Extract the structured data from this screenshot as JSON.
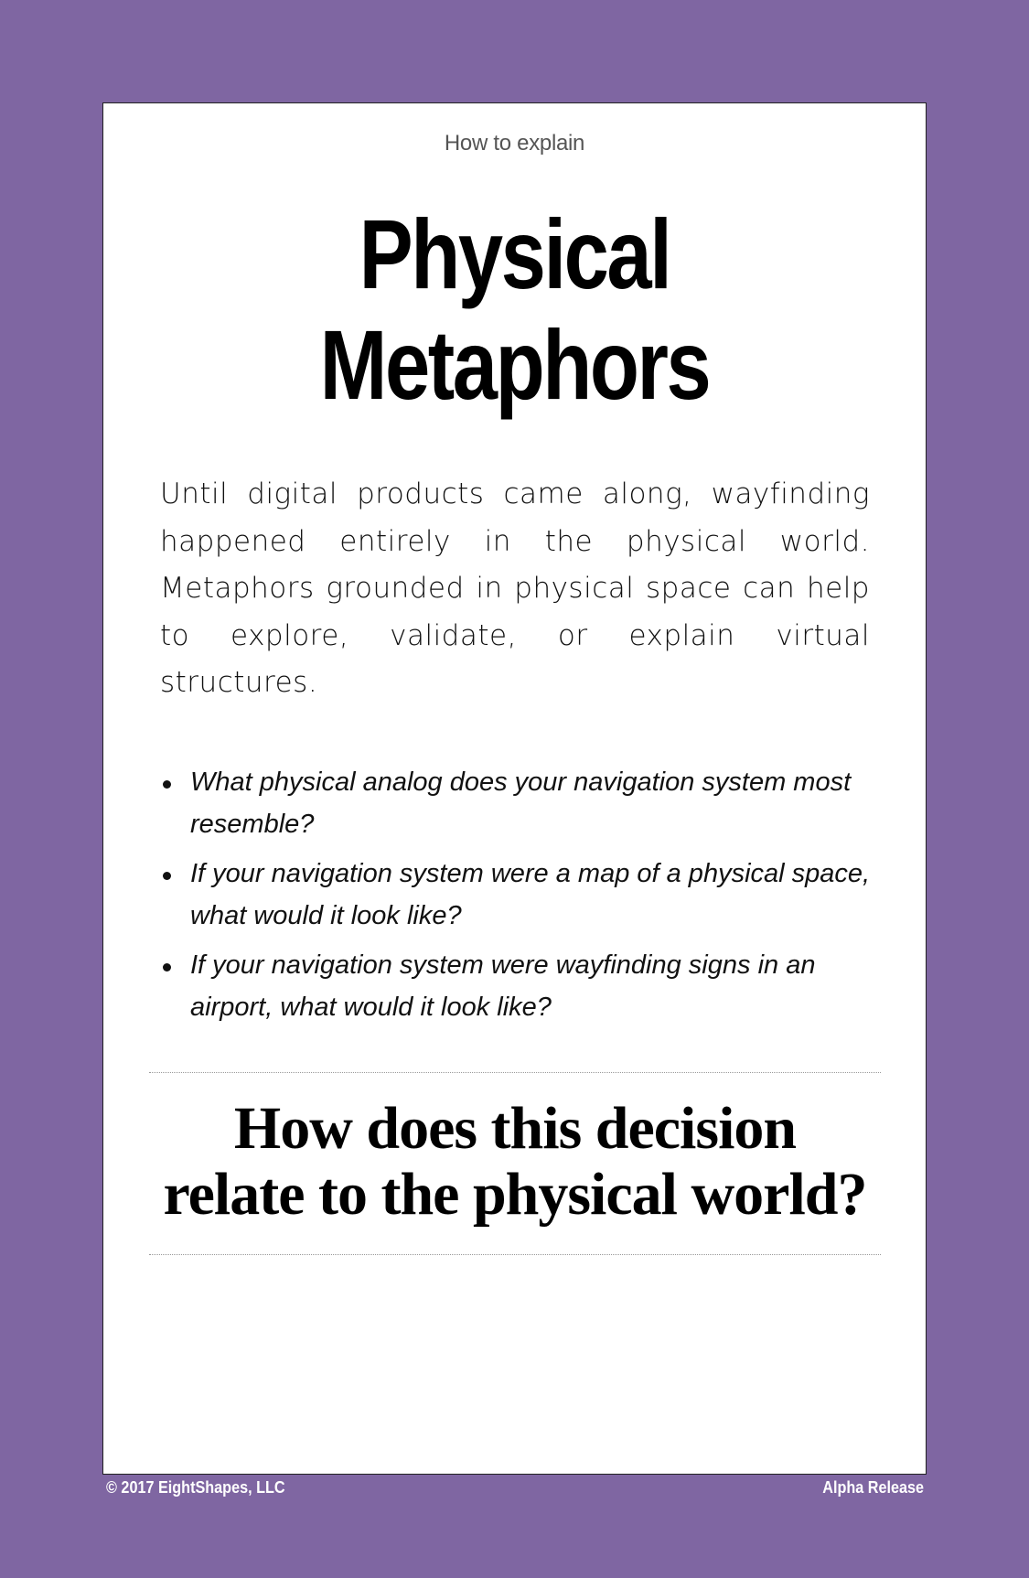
{
  "colors": {
    "background": "#7f66a2",
    "card": "#ffffff",
    "text": "#111111",
    "kicker": "#555555"
  },
  "card": {
    "kicker": "How to explain",
    "title_line1": "Physical",
    "title_line2": "Metaphors",
    "intro": "Until digital products came along, wayfinding happened entirely in the physical world. Metaphors grounded in physical space can help to explore, validate, or explain virtual structures.",
    "questions": [
      "What physical analog does your navigation system most resemble?",
      "If your navigation system were a map of a physical space, what would it look like?",
      "If your navigation system were wayfinding signs in an airport, what would it look like?"
    ],
    "prompt_line1": "How does this decision",
    "prompt_line2": "relate to the physical world?"
  },
  "footer": {
    "copyright": "© 2017 EightShapes, LLC",
    "release": "Alpha Release"
  }
}
